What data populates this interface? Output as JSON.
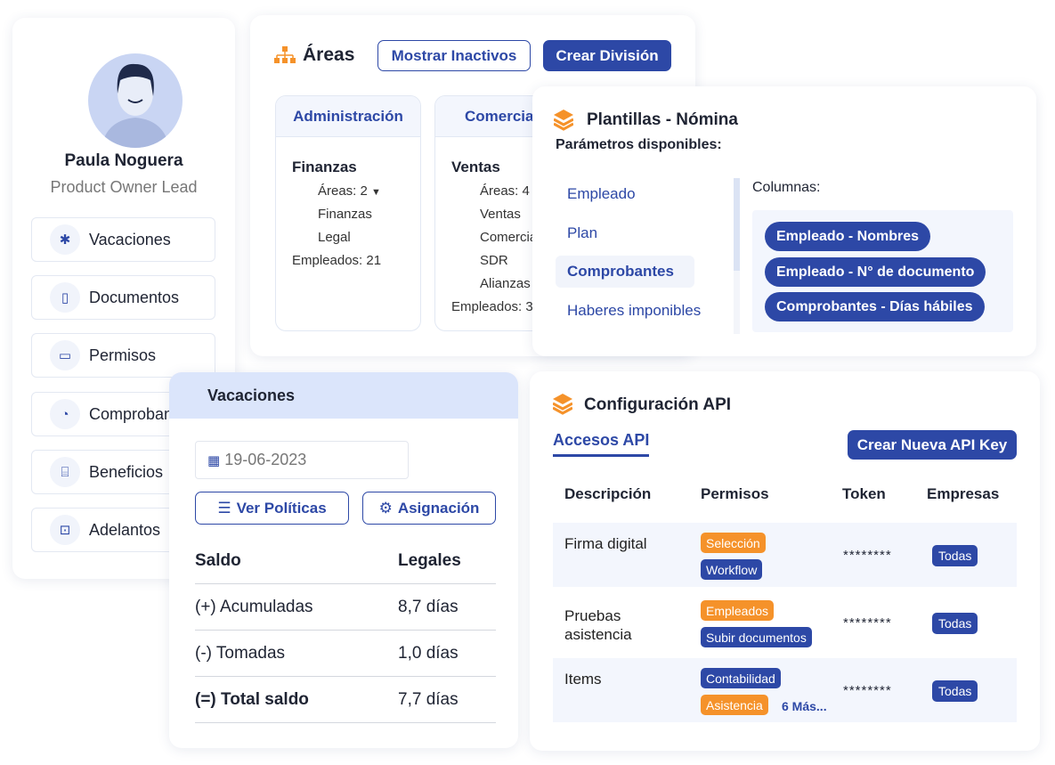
{
  "colors": {
    "primary": "#2d48a6",
    "accent": "#f5922a",
    "header_bg": "#dbe5fb"
  },
  "profile": {
    "name": "Paula Noguera",
    "role": "Product Owner Lead",
    "menu": [
      {
        "label": "Vacaciones",
        "icon": "palm-tree-icon"
      },
      {
        "label": "Documentos",
        "icon": "document-icon"
      },
      {
        "label": "Permisos",
        "icon": "laptop-check-icon"
      },
      {
        "label": "Comprobantes",
        "icon": "piggy-bank-icon"
      },
      {
        "label": "Beneficios",
        "icon": "gift-icon"
      },
      {
        "label": "Adelantos",
        "icon": "money-window-icon"
      }
    ]
  },
  "areas": {
    "title": "Áreas",
    "show_inactive": "Mostrar Inactivos",
    "create_division": "Crear División",
    "divisions": [
      {
        "header": "Administración",
        "name": "Finanzas",
        "areas_count": "Áreas: 2",
        "items": [
          "Finanzas",
          "Legal"
        ],
        "employees": "Empleados: 21"
      },
      {
        "header": "Comercial",
        "name": "Ventas",
        "areas_count": "Áreas: 4",
        "items": [
          "Ventas",
          "Comercial",
          "SDR",
          "Alianzas"
        ],
        "employees": "Empleados: 3"
      }
    ]
  },
  "plantillas": {
    "title": "Plantillas - Nómina",
    "subtitle": "Parámetros disponibles:",
    "params": [
      "Empleado",
      "Plan",
      "Comprobantes",
      "Haberes imponibles"
    ],
    "selected_param": "Comprobantes",
    "columns_label": "Columnas:",
    "columns": [
      "Empleado - Nombres",
      "Empleado - N° de documento",
      "Comprobantes - Días hábiles"
    ]
  },
  "vacaciones": {
    "title": "Vacaciones",
    "date": "19-06-2023",
    "ver_politicas": "Ver Políticas",
    "asignacion": "Asignación",
    "col1": "Saldo",
    "col2": "Legales",
    "rows": [
      {
        "label": "(+) Acumuladas",
        "value": "8,7 días"
      },
      {
        "label": "(-) Tomadas",
        "value": "1,0 días"
      },
      {
        "label": "(=) Total saldo",
        "value": "7,7 días"
      }
    ]
  },
  "api": {
    "title": "Configuración API",
    "tab": "Accesos API",
    "create_key": "Crear Nueva API Key",
    "headers": [
      "Descripción",
      "Permisos",
      "Token",
      "Empresas"
    ],
    "rows": [
      {
        "desc": "Firma digital",
        "tags": [
          {
            "t": "Selección",
            "c": "o"
          },
          {
            "t": "Workflow",
            "c": "b"
          }
        ],
        "token": "********",
        "empresas": "Todas"
      },
      {
        "desc": "Pruebas asistencia",
        "tags": [
          {
            "t": "Empleados",
            "c": "o"
          },
          {
            "t": "Subir documentos",
            "c": "b"
          }
        ],
        "token": "********",
        "empresas": "Todas"
      },
      {
        "desc": "Items",
        "tags": [
          {
            "t": "Contabilidad",
            "c": "b"
          },
          {
            "t": "Asistencia",
            "c": "o"
          }
        ],
        "more": "6 Más...",
        "token": "********",
        "empresas": "Todas"
      }
    ]
  }
}
